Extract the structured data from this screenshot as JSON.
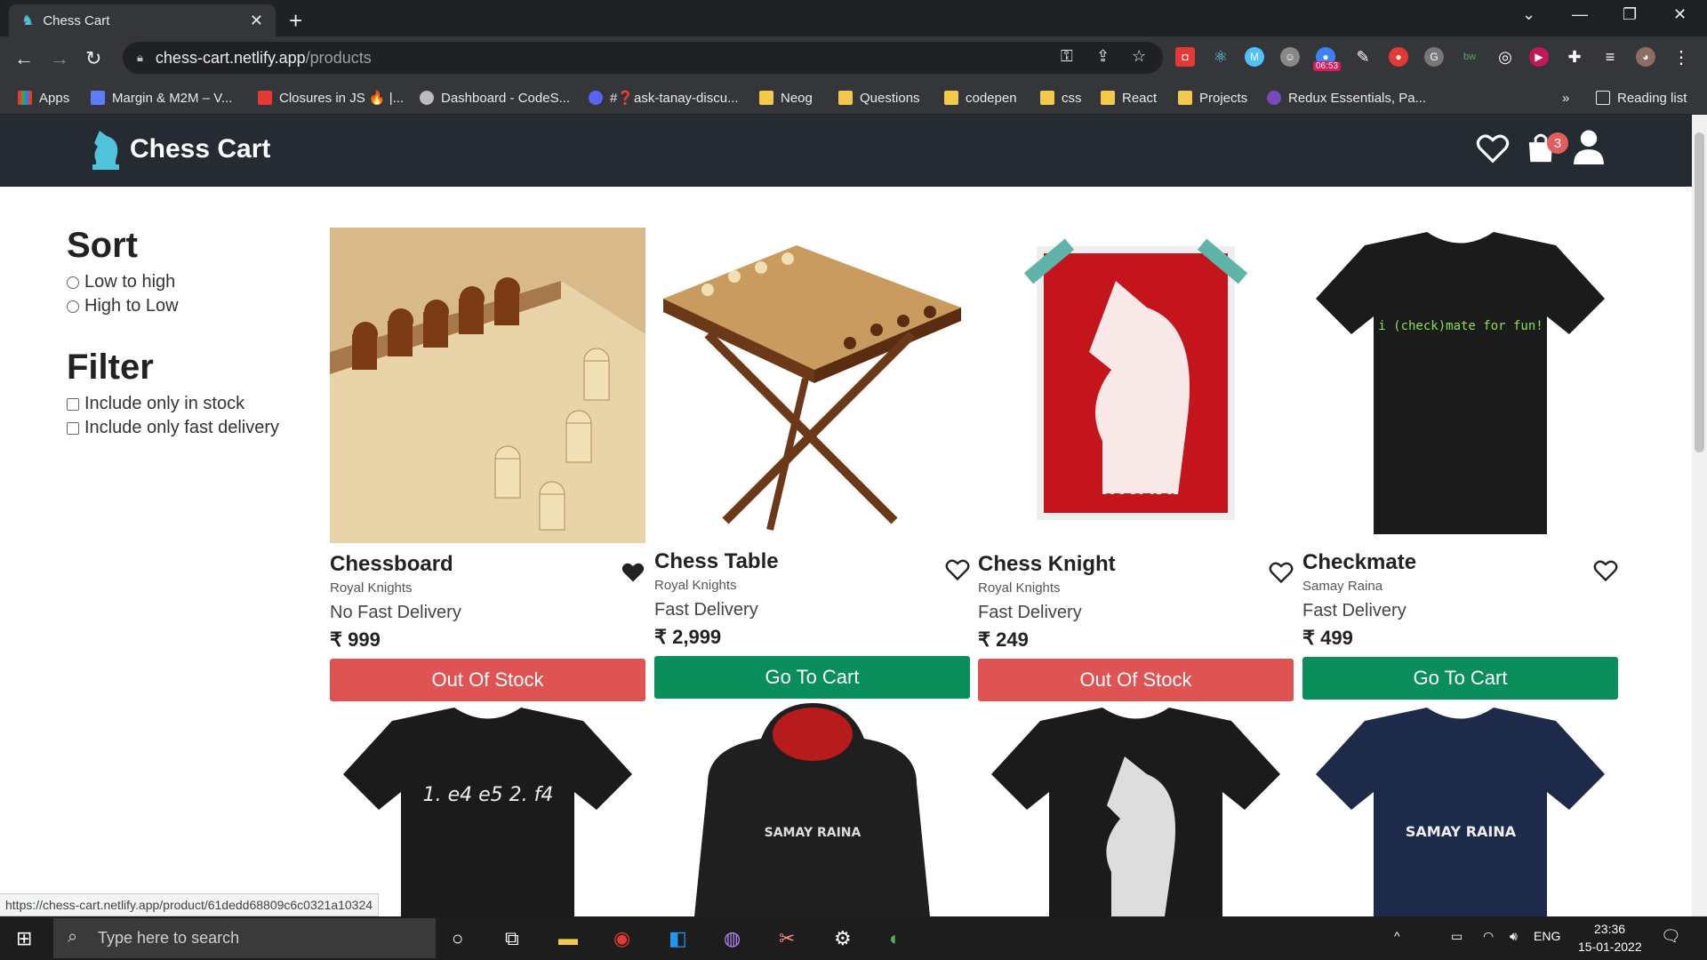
{
  "browser": {
    "tab_title": "Chess Cart",
    "url_host": "chess-cart.netlify.app",
    "url_path": "/products",
    "extension_timer": "06:53",
    "bookmarks": [
      {
        "label": "Apps"
      },
      {
        "label": "Margin & M2M – V..."
      },
      {
        "label": "Closures in JS 🔥 |..."
      },
      {
        "label": "Dashboard - CodeS..."
      },
      {
        "label": "#❓ask-tanay-discu..."
      },
      {
        "label": "Neog"
      },
      {
        "label": "Questions"
      },
      {
        "label": "codepen"
      },
      {
        "label": "css"
      },
      {
        "label": "React"
      },
      {
        "label": "Projects"
      },
      {
        "label": "Redux Essentials, Pa..."
      }
    ],
    "reading_list": "Reading list",
    "more_bookmarks": "»",
    "status_url": "https://chess-cart.netlify.app/product/61dedd68809c6c0321a10324"
  },
  "site": {
    "brand": "Chess Cart",
    "cart_count": "3"
  },
  "sidebar": {
    "sort_heading": "Sort",
    "sort_options": [
      "Low to high",
      "High to Low"
    ],
    "filter_heading": "Filter",
    "filter_options": [
      "Include only in stock",
      "Include only fast delivery"
    ]
  },
  "products": [
    {
      "name": "Chessboard",
      "brand": "Royal Knights",
      "delivery": "No Fast Delivery",
      "price": "₹ 999",
      "button": "Out Of Stock",
      "wishlisted": true
    },
    {
      "name": "Chess Table",
      "brand": "Royal Knights",
      "delivery": "Fast Delivery",
      "price": "₹ 2,999",
      "button": "Go To Cart",
      "wishlisted": false
    },
    {
      "name": "Chess Knight",
      "brand": "Royal Knights",
      "delivery": "Fast Delivery",
      "price": "₹ 249",
      "button": "Out Of Stock",
      "wishlisted": false
    },
    {
      "name": "Checkmate",
      "brand": "Samay Raina",
      "delivery": "Fast Delivery",
      "price": "₹ 499",
      "button": "Go To Cart",
      "wishlisted": false
    }
  ],
  "product_images": {
    "poster_word": "RESPECTABLE",
    "tshirt_text": "i (check)mate for fun!",
    "tshirt2_text": "1. e4 e5 2. f4",
    "hoodie_text": "SAMAY RAINA",
    "tshirt4_text": "SAMAY RAINA"
  },
  "taskbar": {
    "search_placeholder": "Type here to search",
    "lang": "ENG",
    "time": "23:36",
    "date": "15-01-2022"
  },
  "colors": {
    "navbar": "#252b33",
    "out_of_stock": "#e05353",
    "go_to_cart": "#098e5c",
    "brand_icon": "#4fc3d9"
  }
}
